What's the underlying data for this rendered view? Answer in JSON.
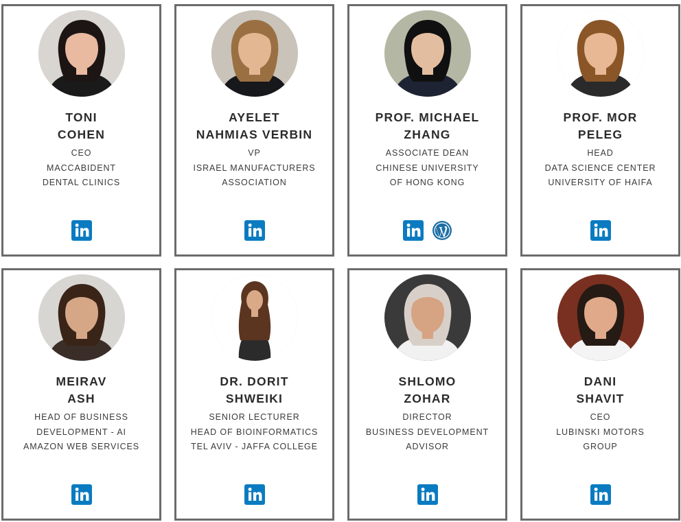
{
  "colors": {
    "card_border": "#6b6b6b",
    "linkedin": "#0a7bc1",
    "wordpress": "#1e6fa6",
    "text": "#2b2b2b"
  },
  "people": [
    {
      "name_line1": "TONI",
      "name_line2": "COHEN",
      "info": [
        "CEO",
        "MACCABIDENT",
        "DENTAL CLINICS"
      ],
      "links": [
        "linkedin-icon"
      ],
      "photo": {
        "bg": "#d9d5d0",
        "hair": "#1c1514",
        "skin": "#e9b9a0",
        "shirt": "#1a1a1a"
      }
    },
    {
      "name_line1": "AYELET",
      "name_line2": "NAHMIAS VERBIN",
      "info": [
        "VP",
        "ISRAEL MANUFACTURERS",
        "ASSOCIATION"
      ],
      "links": [
        "linkedin-icon"
      ],
      "photo": {
        "bg": "#c9c3ba",
        "hair": "#9a7042",
        "skin": "#e3b792",
        "shirt": "#16181c"
      }
    },
    {
      "name_line1": "PROF. MICHAEL",
      "name_line2": "ZHANG",
      "info": [
        "ASSOCIATE DEAN",
        "CHINESE UNIVERSITY",
        "OF HONG KONG"
      ],
      "links": [
        "linkedin-icon",
        "wordpress-icon"
      ],
      "photo": {
        "bg": "#b4b7a4",
        "hair": "#101010",
        "skin": "#e3bda0",
        "shirt": "#1d2333"
      }
    },
    {
      "name_line1": "PROF. MOR",
      "name_line2": "PELEG",
      "info": [
        "HEAD",
        "DATA SCIENCE CENTER",
        "UNIVERSITY OF HAIFA"
      ],
      "links": [
        "linkedin-icon"
      ],
      "photo": {
        "bg": "#ffffff",
        "hair": "#8a5628",
        "skin": "#e8b793",
        "shirt": "#2a2a2a"
      }
    },
    {
      "name_line1": "MEIRAV",
      "name_line2": "ASH",
      "info": [
        "HEAD OF BUSINESS",
        "DEVELOPMENT - AI",
        "AMAZON WEB SERVICES"
      ],
      "links": [
        "linkedin-icon"
      ],
      "photo": {
        "bg": "#d8d6d2",
        "hair": "#3a2418",
        "skin": "#d6a787",
        "shirt": "#3b2e28"
      }
    },
    {
      "name_line1": "DR. DORIT",
      "name_line2": "SHWEIKI",
      "info": [
        "SENIOR LECTURER",
        "HEAD OF BIOINFORMATICS",
        "TEL AVIV - JAFFA COLLEGE"
      ],
      "links": [
        "linkedin-icon"
      ],
      "photo": {
        "bg": "#ffffff",
        "hair": "#5b3520",
        "skin": "#d9a988",
        "shirt": "#2b2b2b"
      }
    },
    {
      "name_line1": "SHLOMO",
      "name_line2": "ZOHAR",
      "info": [
        "DIRECTOR",
        "BUSINESS DEVELOPMENT",
        "ADVISOR"
      ],
      "links": [
        "linkedin-icon"
      ],
      "photo": {
        "bg": "#3a3a3a",
        "hair": "#d8d0c8",
        "skin": "#d6a383",
        "shirt": "#f1f1f1"
      }
    },
    {
      "name_line1": "DANI",
      "name_line2": "SHAVIT",
      "info": [
        "CEO",
        "LUBINSKI MOTORS",
        "GROUP"
      ],
      "links": [
        "linkedin-icon"
      ],
      "photo": {
        "bg": "#7a3020",
        "hair": "#251a14",
        "skin": "#e0a98a",
        "shirt": "#f4f4f4"
      }
    }
  ]
}
